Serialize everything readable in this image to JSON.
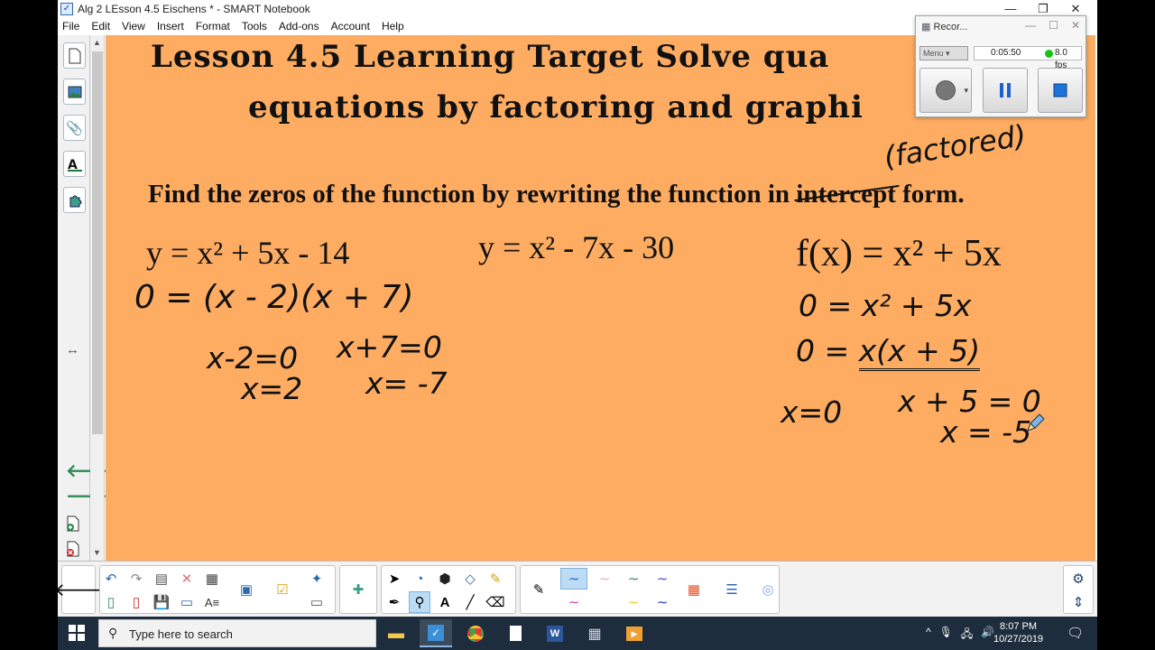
{
  "window": {
    "title": "Alg 2 LEsson 4.5   Eischens * - SMART Notebook",
    "minimize": "—",
    "maximize": "❐",
    "close": "✕"
  },
  "menu": [
    "File",
    "Edit",
    "View",
    "Insert",
    "Format",
    "Tools",
    "Add-ons",
    "Account",
    "Help"
  ],
  "recorder": {
    "title": "Recor...",
    "menu_label": "Menu",
    "elapsed": "0:05:50",
    "fps": "8.0 fps",
    "status_color": "#19c219"
  },
  "page": {
    "background": "#fdac62",
    "title_line1": "Lesson 4.5  Learning Target Solve qua",
    "title_line2": "equations by factoring and graphi",
    "annotation_factored": "(factored)",
    "instruction_before": "Find the zeros of the function by rewriting the function in ",
    "instruction_struck": "intercept",
    "instruction_after": " form.",
    "problem1": {
      "equation": "y = x² + 5x - 14",
      "factored": "0 = (x - 2)(x + 7)",
      "step_a1": "x-2=0",
      "step_a2": "x=2",
      "step_b1": "x+7=0",
      "step_b2": "x= -7"
    },
    "problem2": {
      "equation": "y = x² - 7x - 30"
    },
    "problem3": {
      "equation": "f(x) = x² + 5x",
      "step1": "0 = x² + 5x",
      "step2_pre": "0 = ",
      "step2_x": "x",
      "step2_paren": "(x + 5)",
      "step3a": "x=0",
      "step3b": "x + 5 = 0",
      "step3c": "x = -5"
    }
  },
  "taskbar": {
    "search_placeholder": "Type here to search",
    "time": "8:07 PM",
    "date": "10/27/2019"
  }
}
